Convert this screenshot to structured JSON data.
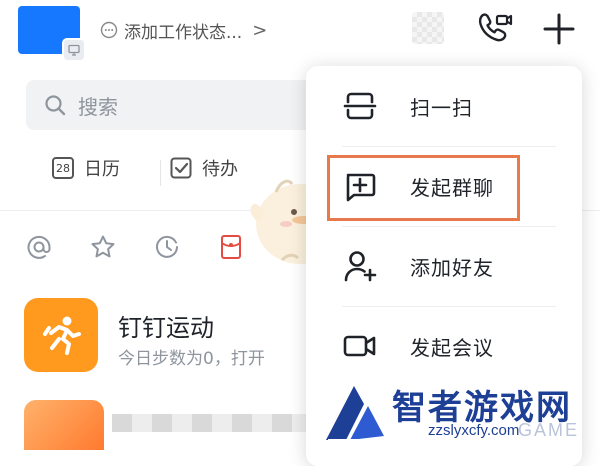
{
  "header": {
    "status_text": "添加工作状态...",
    "status_chevron": ">",
    "avatar_badge_icon": "computer-icon",
    "accent_color": "#1677ff"
  },
  "search": {
    "placeholder": "搜索"
  },
  "quick_actions": [
    {
      "label": "日历",
      "icon": "calendar-icon",
      "badge": "28"
    },
    {
      "label": "待办",
      "icon": "todo-check-icon"
    }
  ],
  "filters": [
    {
      "icon": "at-icon"
    },
    {
      "icon": "star-icon"
    },
    {
      "icon": "clock-icon"
    },
    {
      "icon": "red-packet-icon"
    }
  ],
  "chat_list": [
    {
      "title": "钉钉运动",
      "subtitle": "今日步数为0，打开",
      "icon": "running-icon",
      "icon_color": "#ff9a1f"
    }
  ],
  "popup_menu": {
    "items": [
      {
        "label": "扫一扫",
        "icon": "scan-icon"
      },
      {
        "label": "发起群聊",
        "icon": "group-chat-icon",
        "highlighted": true
      },
      {
        "label": "添加好友",
        "icon": "add-friend-icon"
      },
      {
        "label": "发起会议",
        "icon": "video-meeting-icon"
      }
    ],
    "highlight_color": "#e8794f"
  },
  "watermark": {
    "title": "智者游戏网",
    "url": "zzslyxcfy.com",
    "ghost_text": "GAME",
    "color": "#1d3f95"
  }
}
